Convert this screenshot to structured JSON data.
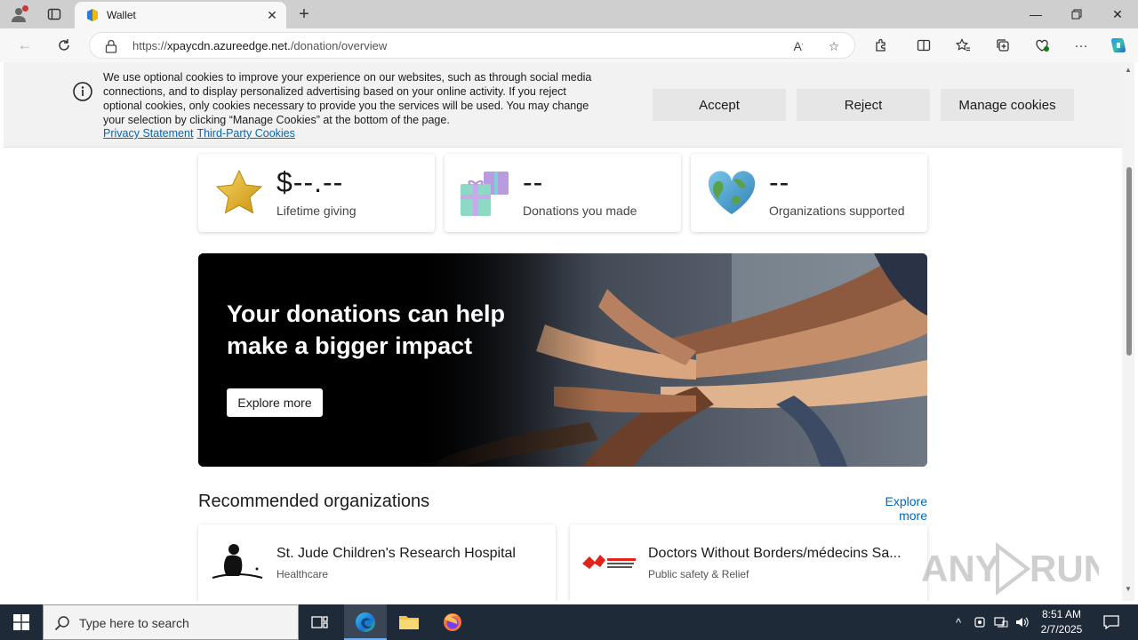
{
  "browser": {
    "tab_title": "Wallet",
    "url_prefix": "https://",
    "url_host": "xpaycdn.azureedge.net.",
    "url_path": "/donation/overview"
  },
  "cookie_banner": {
    "text": "We use optional cookies to improve your experience on our websites, such as through social media connections, and to display personalized advertising based on your online activity. If you reject optional cookies, only cookies necessary to provide you the services will be used. You may change your selection by clicking “Manage Cookies” at the bottom of the page.",
    "privacy_link": "Privacy Statement",
    "third_party_link": "Third-Party Cookies",
    "accept_label": "Accept",
    "reject_label": "Reject",
    "manage_label": "Manage cookies"
  },
  "stats": [
    {
      "value": "$--.--",
      "label": "Lifetime giving",
      "icon": "star-icon"
    },
    {
      "value": "--",
      "label": "Donations you made",
      "icon": "gift-icon"
    },
    {
      "value": "--",
      "label": "Organizations supported",
      "icon": "globe-heart-icon"
    }
  ],
  "hero": {
    "title": "Your donations can help make a bigger impact",
    "button_label": "Explore more"
  },
  "recommended": {
    "title": "Recommended organizations",
    "explore_label": "Explore more",
    "orgs": [
      {
        "name": "St. Jude Children's Research Hospital",
        "category": "Healthcare"
      },
      {
        "name": "Doctors Without Borders/médecins Sa...",
        "category": "Public safety & Relief"
      }
    ]
  },
  "taskbar": {
    "search_placeholder": "Type here to search",
    "time": "8:51 AM",
    "date": "2/7/2025"
  },
  "colors": {
    "link": "#0067b8",
    "taskbar": "#1f2a38",
    "banner_bg": "#f2f2f2"
  }
}
